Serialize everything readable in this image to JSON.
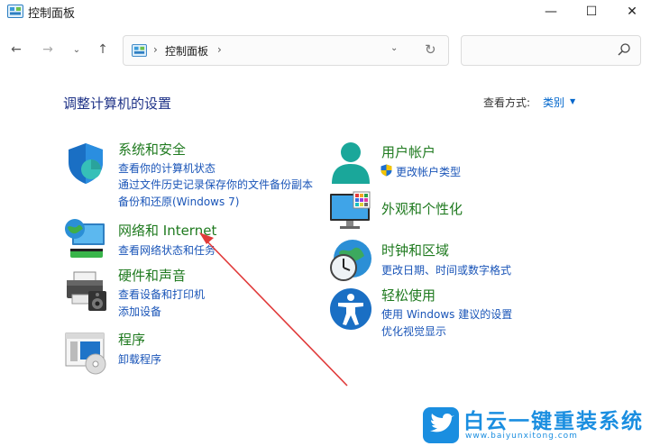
{
  "window": {
    "title": "控制面板",
    "minimize": "—",
    "maximize": "☐",
    "close": "✕"
  },
  "nav": {
    "back": "←",
    "forward": "→",
    "recent": "⌄",
    "up": "↑",
    "address_sep": "›",
    "address_text": "控制面板",
    "address_sep2": "›",
    "dropdown": "⌄",
    "refresh": "↻",
    "search_placeholder": ""
  },
  "header": {
    "title": "调整计算机的设置",
    "view_by_label": "查看方式:",
    "view_by_value": "类别"
  },
  "left_categories": [
    {
      "icon": "security-shield-icon",
      "title": "系统和安全",
      "links": [
        "查看你的计算机状态",
        "通过文件历史记录保存你的文件备份副本",
        "备份和还原(Windows 7)"
      ]
    },
    {
      "icon": "network-globe-icon",
      "title": "网络和 Internet",
      "links": [
        "查看网络状态和任务"
      ]
    },
    {
      "icon": "printer-speaker-icon",
      "title": "硬件和声音",
      "links": [
        "查看设备和打印机",
        "添加设备"
      ]
    },
    {
      "icon": "programs-disc-icon",
      "title": "程序",
      "links": [
        "卸载程序"
      ]
    }
  ],
  "right_categories": [
    {
      "icon": "user-accounts-icon",
      "title": "用户帐户",
      "links": [
        "更改帐户类型"
      ]
    },
    {
      "icon": "appearance-monitor-icon",
      "title": "外观和个性化",
      "links": []
    },
    {
      "icon": "clock-globe-icon",
      "title": "时钟和区域",
      "links": [
        "更改日期、时间或数字格式"
      ]
    },
    {
      "icon": "accessibility-icon",
      "title": "轻松使用",
      "links": [
        "使用 Windows 建议的设置",
        "优化视觉显示"
      ]
    }
  ],
  "watermark": {
    "main": "白云一键重装系统",
    "url": "www.baiyunxitong.com"
  },
  "colors": {
    "category_title": "#1f7a1f",
    "link": "#1a55b8",
    "page_title": "#1e3287",
    "annotation_arrow": "#e03a3a",
    "watermark": "#1a8ee0"
  }
}
